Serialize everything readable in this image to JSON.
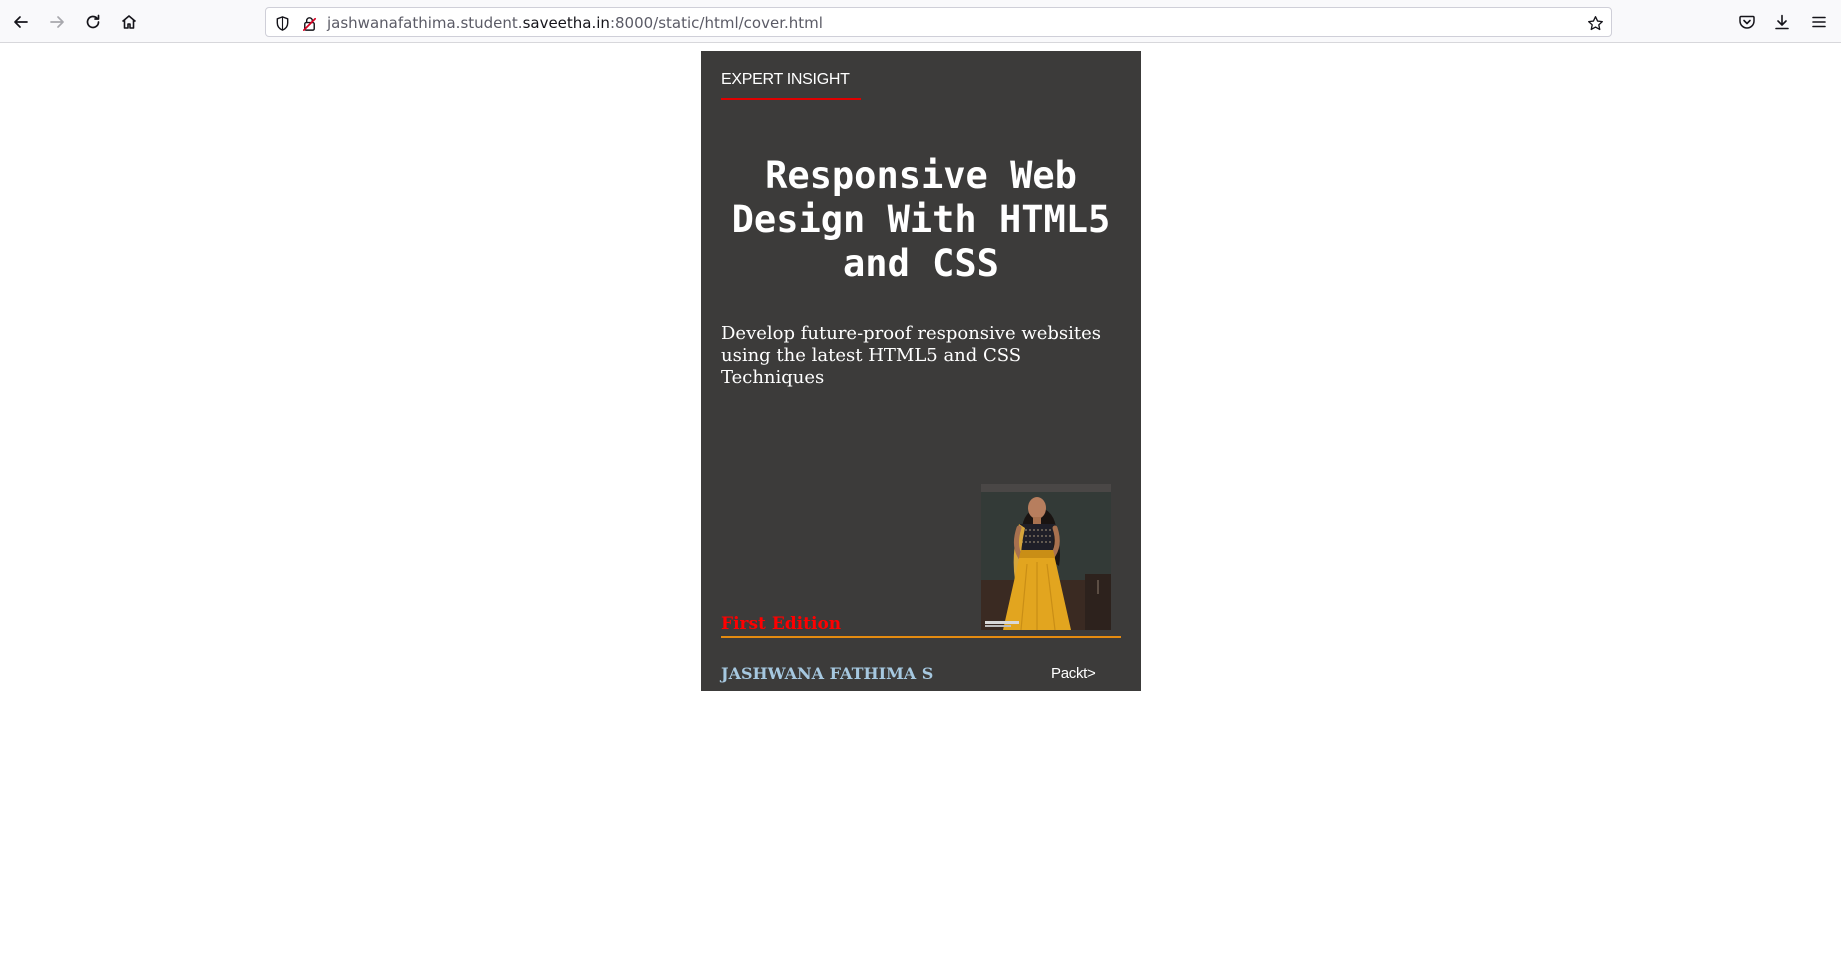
{
  "browser": {
    "url_prefix": "jashwanafathima.student.",
    "url_domain": "saveetha.in",
    "url_suffix": ":8000/static/html/cover.html",
    "icons": {
      "back": "back-arrow-icon",
      "forward": "forward-arrow-icon",
      "reload": "reload-icon",
      "home": "home-icon",
      "tracking": "shield-icon",
      "security": "insecure-lock-icon",
      "bookmark": "star-icon",
      "pocket": "pocket-icon",
      "downloads": "download-icon",
      "menu": "hamburger-menu-icon"
    }
  },
  "cover": {
    "series": "EXPERT INSIGHT",
    "title": "Responsive Web Design With HTML5 and CSS",
    "subtitle": "Develop future-proof responsive websites using the latest HTML5 and CSS Techniques",
    "edition": "First Edition",
    "author": "JASHWANA FATHIMA S",
    "publisher": "Packt>",
    "colors": {
      "background": "#3c3b3a",
      "series_rule": "#e00000",
      "edition_text": "#ff0000",
      "edition_rule": "#e58b10",
      "author_text": "#a6c8e0"
    }
  }
}
